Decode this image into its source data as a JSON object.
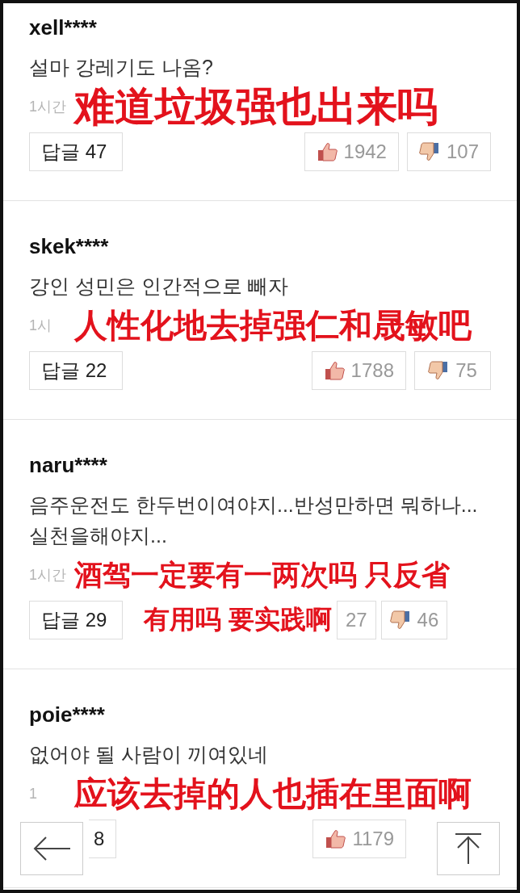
{
  "comments": [
    {
      "username": "xell****",
      "text": "설마 강레기도 나옴?",
      "timestamp": "1시간",
      "translation": [
        "难道垃圾强也出来吗"
      ],
      "reply_label": "답글",
      "reply_count": "47",
      "like_count": "1942",
      "dislike_count": "107"
    },
    {
      "username": "skek****",
      "text": "강인 성민은 인간적으로 빼자",
      "timestamp": "1시",
      "translation": [
        "人性化地去掉强仁和晟敏吧"
      ],
      "reply_label": "답글",
      "reply_count": "22",
      "like_count": "1788",
      "dislike_count": "75"
    },
    {
      "username": "naru****",
      "text": "음주운전도 한두번이여야지...반성만하면 뭐하나...실천을해야지...",
      "timestamp": "1시간",
      "translation": [
        "酒驾一定要有一两次吗 只反省",
        "有用吗 要实践啊"
      ],
      "reply_label": "답글",
      "reply_count": "29",
      "like_count": "27",
      "dislike_count": "46"
    },
    {
      "username": "poie****",
      "text": "없어야 될 사람이 끼여있네",
      "timestamp": "1",
      "translation": [
        "应该去掉的人也插在里面啊"
      ],
      "reply_count": "8",
      "like_count": "1179"
    }
  ]
}
